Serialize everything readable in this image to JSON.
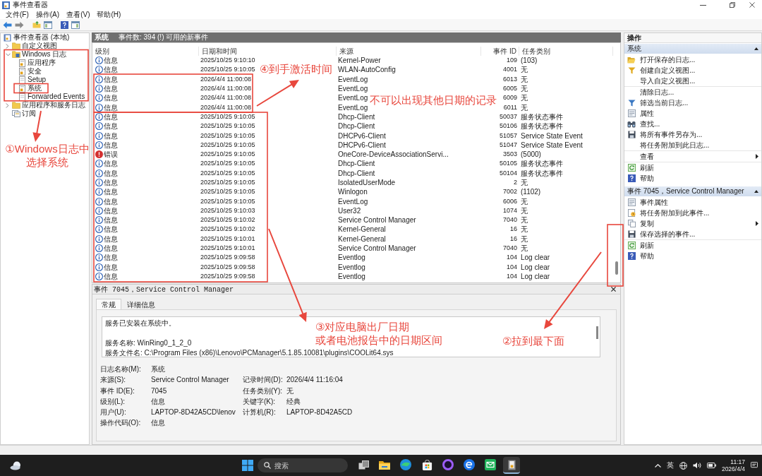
{
  "window": {
    "title": "事件查看器"
  },
  "menu": [
    {
      "label": "文件(F)"
    },
    {
      "label": "操作(A)"
    },
    {
      "label": "查看(V)"
    },
    {
      "label": "帮助(H)"
    }
  ],
  "tree": {
    "root": "事件查看器 (本地)",
    "items": [
      {
        "label": "自定义视图",
        "kind": "folder",
        "expandable": true,
        "expanded": false
      },
      {
        "label": "Windows 日志",
        "kind": "logs",
        "expandable": true,
        "expanded": true,
        "children": [
          {
            "label": "应用程序",
            "kind": "log"
          },
          {
            "label": "安全",
            "kind": "log"
          },
          {
            "label": "Setup",
            "kind": "plain"
          },
          {
            "label": "系统",
            "kind": "log"
          },
          {
            "label": "Forwarded Events",
            "kind": "plain"
          }
        ]
      },
      {
        "label": "应用程序和服务日志",
        "kind": "folder",
        "expandable": true,
        "expanded": false
      },
      {
        "label": "订阅",
        "kind": "subscription",
        "expandable": false,
        "expanded": false
      }
    ]
  },
  "log_view": {
    "title": "系统",
    "summary": "事件数: 394 (!) 可用的新事件",
    "columns": [
      "级别",
      "日期和时间",
      "来源",
      "事件 ID",
      "任务类别"
    ],
    "rows": [
      {
        "kind": "info",
        "level": "信息",
        "date": "2025/10/25 9:10:10",
        "source": "Kernel-Power",
        "event_id": "109",
        "category": "(103)"
      },
      {
        "kind": "info",
        "level": "信息",
        "date": "2025/10/25 9:10:05",
        "source": "WLAN-AutoConfig",
        "event_id": "4001",
        "category": "无"
      },
      {
        "kind": "info",
        "level": "信息",
        "date": "2026/4/4 11:00:08",
        "source": "EventLog",
        "event_id": "6013",
        "category": "无"
      },
      {
        "kind": "info",
        "level": "信息",
        "date": "2026/4/4 11:00:08",
        "source": "EventLog",
        "event_id": "6005",
        "category": "无"
      },
      {
        "kind": "info",
        "level": "信息",
        "date": "2026/4/4 11:00:08",
        "source": "EventLog",
        "event_id": "6009",
        "category": "无"
      },
      {
        "kind": "info",
        "level": "信息",
        "date": "2026/4/4 11:00:08",
        "source": "EventLog",
        "event_id": "6011",
        "category": "无"
      },
      {
        "kind": "info",
        "level": "信息",
        "date": "2025/10/25 9:10:05",
        "source": "Dhcp-Client",
        "event_id": "50037",
        "category": "服务状态事件"
      },
      {
        "kind": "info",
        "level": "信息",
        "date": "2025/10/25 9:10:05",
        "source": "Dhcp-Client",
        "event_id": "50106",
        "category": "服务状态事件"
      },
      {
        "kind": "info",
        "level": "信息",
        "date": "2025/10/25 9:10:05",
        "source": "DHCPv6-Client",
        "event_id": "51057",
        "category": "Service State Event"
      },
      {
        "kind": "info",
        "level": "信息",
        "date": "2025/10/25 9:10:05",
        "source": "DHCPv6-Client",
        "event_id": "51047",
        "category": "Service State Event"
      },
      {
        "kind": "error",
        "level": "错误",
        "date": "2025/10/25 9:10:05",
        "source": "OneCore-DeviceAssociationServi...",
        "event_id": "3503",
        "category": "(5000)"
      },
      {
        "kind": "info",
        "level": "信息",
        "date": "2025/10/25 9:10:05",
        "source": "Dhcp-Client",
        "event_id": "50105",
        "category": "服务状态事件"
      },
      {
        "kind": "info",
        "level": "信息",
        "date": "2025/10/25 9:10:05",
        "source": "Dhcp-Client",
        "event_id": "50104",
        "category": "服务状态事件"
      },
      {
        "kind": "info",
        "level": "信息",
        "date": "2025/10/25 9:10:05",
        "source": "IsolatedUserMode",
        "event_id": "2",
        "category": "无"
      },
      {
        "kind": "info",
        "level": "信息",
        "date": "2025/10/25 9:10:05",
        "source": "Winlogon",
        "event_id": "7002",
        "category": "(1102)"
      },
      {
        "kind": "info",
        "level": "信息",
        "date": "2025/10/25 9:10:05",
        "source": "EventLog",
        "event_id": "6006",
        "category": "无"
      },
      {
        "kind": "info",
        "level": "信息",
        "date": "2025/10/25 9:10:03",
        "source": "User32",
        "event_id": "1074",
        "category": "无"
      },
      {
        "kind": "info",
        "level": "信息",
        "date": "2025/10/25 9:10:02",
        "source": "Service Control Manager",
        "event_id": "7040",
        "category": "无"
      },
      {
        "kind": "info",
        "level": "信息",
        "date": "2025/10/25 9:10:02",
        "source": "Kernel-General",
        "event_id": "16",
        "category": "无"
      },
      {
        "kind": "info",
        "level": "信息",
        "date": "2025/10/25 9:10:01",
        "source": "Kernel-General",
        "event_id": "16",
        "category": "无"
      },
      {
        "kind": "info",
        "level": "信息",
        "date": "2025/10/25 9:10:01",
        "source": "Service Control Manager",
        "event_id": "7040",
        "category": "无"
      },
      {
        "kind": "info",
        "level": "信息",
        "date": "2025/10/25 9:09:58",
        "source": "Eventlog",
        "event_id": "104",
        "category": "Log clear"
      },
      {
        "kind": "info",
        "level": "信息",
        "date": "2025/10/25 9:09:58",
        "source": "Eventlog",
        "event_id": "104",
        "category": "Log clear"
      },
      {
        "kind": "info",
        "level": "信息",
        "date": "2025/10/25 9:09:58",
        "source": "Eventlog",
        "event_id": "104",
        "category": "Log clear"
      }
    ]
  },
  "event_details": {
    "title": "事件 7045，Service Control Manager",
    "tabs": [
      {
        "label": "常规",
        "selected": true
      },
      {
        "label": "详细信息",
        "selected": false
      }
    ],
    "message": [
      [
        "服务已安装在系统中。"
      ],
      [
        "服务名称: WinRing0_1_2_0",
        "服务文件名: C:\\Program Files (x86)\\Lenovo\\PCManager\\5.1.85.10081\\plugins\\COOLit64.sys"
      ]
    ],
    "fields": [
      [
        {
          "label": "日志名称(M):",
          "value": "系统"
        }
      ],
      [
        {
          "label": "来源(S):",
          "value": "Service Control Manager"
        },
        {
          "label": "记录时间(D):",
          "value": "2026/4/4 11:16:04"
        }
      ],
      [
        {
          "label": "事件 ID(E):",
          "value": "7045"
        },
        {
          "label": "任务类别(Y):",
          "value": "无"
        }
      ],
      [
        {
          "label": "级别(L):",
          "value": "信息"
        },
        {
          "label": "关键字(K):",
          "value": "经典"
        }
      ],
      [
        {
          "label": "用户(U):",
          "value": "LAPTOP-8D42A5CD\\lenov"
        },
        {
          "label": "计算机(R):",
          "value": "LAPTOP-8D42A5CD"
        }
      ],
      [
        {
          "label": "操作代码(O):",
          "value": "信息"
        }
      ]
    ]
  },
  "actions": {
    "title": "操作",
    "sections": [
      {
        "title": "系统",
        "expanded": true,
        "groups": [
          [
            {
              "label": "打开保存的日志...",
              "kind": "open",
              "submenu": false
            },
            {
              "label": "创建自定义视图...",
              "kind": "new-view",
              "submenu": false
            },
            {
              "label": "导入自定义视图...",
              "kind": "plain",
              "submenu": false
            }
          ],
          [
            {
              "label": "清除日志...",
              "kind": "plain",
              "submenu": false
            },
            {
              "label": "筛选当前日志...",
              "kind": "filter",
              "submenu": false
            },
            {
              "label": "属性",
              "kind": "properties",
              "submenu": false
            },
            {
              "label": "查找...",
              "kind": "find",
              "submenu": false
            },
            {
              "label": "将所有事件另存为...",
              "kind": "save",
              "submenu": false
            },
            {
              "label": "将任务附加到此日志...",
              "kind": "plain",
              "submenu": false
            }
          ],
          [
            {
              "label": "查看",
              "kind": "plain",
              "submenu": true
            }
          ],
          [
            {
              "label": "刷新",
              "kind": "refresh",
              "submenu": false
            },
            {
              "label": "帮助",
              "kind": "help",
              "submenu": false
            }
          ]
        ]
      },
      {
        "title": "事件 7045，Service Control Manager",
        "expanded": true,
        "groups": [
          [
            {
              "label": "事件属性",
              "kind": "properties",
              "submenu": false
            },
            {
              "label": "将任务附加到此事件...",
              "kind": "task",
              "submenu": false
            },
            {
              "label": "复制",
              "kind": "copy",
              "submenu": true
            },
            {
              "label": "保存选择的事件...",
              "kind": "save",
              "submenu": false
            }
          ],
          [
            {
              "label": "刷新",
              "kind": "refresh",
              "submenu": false
            },
            {
              "label": "帮助",
              "kind": "help",
              "submenu": false
            }
          ]
        ]
      }
    ]
  },
  "taskbar": {
    "search": {
      "placeholder": "搜索"
    },
    "apps": [
      {
        "kind": "task-view",
        "active": false
      },
      {
        "kind": "explorer",
        "active": false
      },
      {
        "kind": "edge",
        "active": false
      },
      {
        "kind": "store",
        "active": false
      },
      {
        "kind": "orb",
        "active": false
      },
      {
        "kind": "browser",
        "active": false
      },
      {
        "kind": "mail",
        "active": false
      },
      {
        "kind": "event-viewer",
        "active": true
      }
    ],
    "tray": {
      "input": "英",
      "time": "11:17",
      "date": "2026/4/4"
    }
  },
  "annotations": [
    {
      "lines": [
        "①Windows日志中",
        "选择系统"
      ]
    },
    {
      "lines": [
        "④到手激活时间"
      ]
    },
    {
      "lines": [
        "不可以出现其他日期的记录"
      ]
    },
    {
      "lines": [
        "③对应电脑出厂日期",
        "或者电池报告中的日期区间"
      ]
    },
    {
      "lines": [
        "②拉到最下面"
      ]
    }
  ]
}
